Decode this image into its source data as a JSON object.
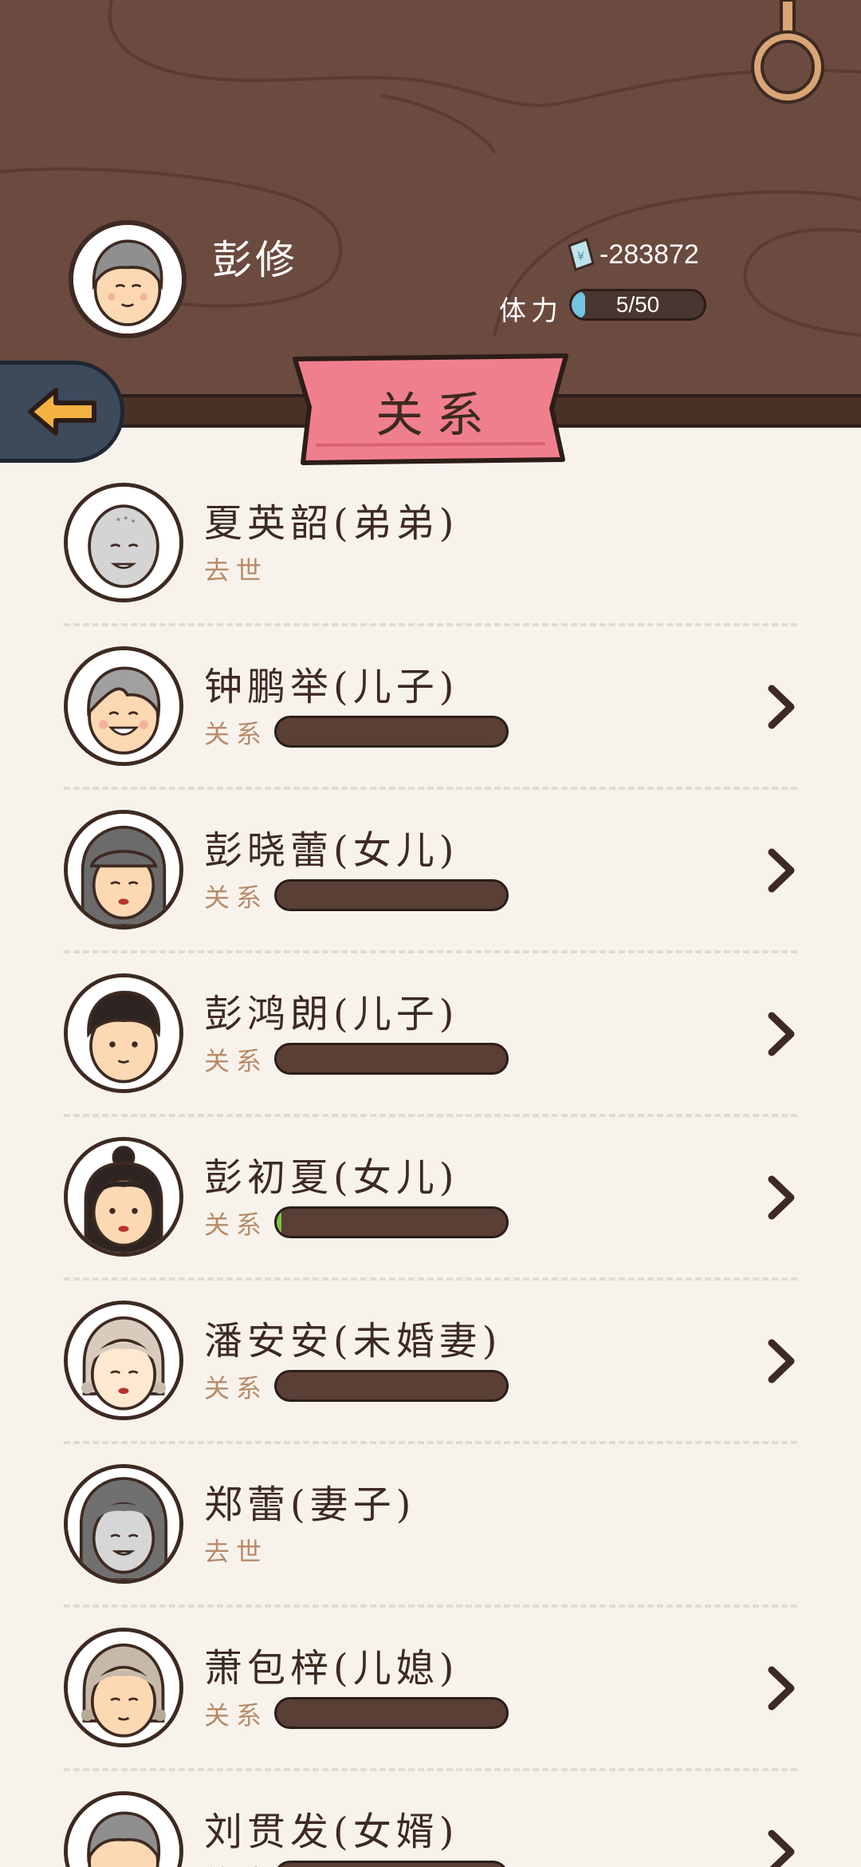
{
  "header": {
    "player_name": "彭修",
    "money": "-283872",
    "stamina_label": "体力",
    "stamina_text": "5/50",
    "stamina_fraction": 0.1,
    "back_icon": "arrow-left-icon"
  },
  "page_title": "关系",
  "members": [
    {
      "name": "夏英韶(弟弟)",
      "status": "去世",
      "deceased": true,
      "relation_fraction": 0
    },
    {
      "name": "钟鹏举(儿子)",
      "status": "关系",
      "deceased": false,
      "relation_fraction": 0
    },
    {
      "name": "彭晓蕾(女儿)",
      "status": "关系",
      "deceased": false,
      "relation_fraction": 0
    },
    {
      "name": "彭鸿朗(儿子)",
      "status": "关系",
      "deceased": false,
      "relation_fraction": 0
    },
    {
      "name": "彭初夏(女儿)",
      "status": "关系",
      "deceased": false,
      "relation_fraction": 0.02
    },
    {
      "name": "潘安安(未婚妻)",
      "status": "关系",
      "deceased": false,
      "relation_fraction": 0
    },
    {
      "name": "郑蕾(妻子)",
      "status": "去世",
      "deceased": true,
      "relation_fraction": 0
    },
    {
      "name": "萧包梓(儿媳)",
      "status": "关系",
      "deceased": false,
      "relation_fraction": 0
    },
    {
      "name": "刘贯发(女婿)",
      "status": "关系",
      "deceased": false,
      "relation_fraction": 0
    }
  ],
  "colors": {
    "header_bg": "#6b4a3f",
    "page_bg": "#f7f3ec",
    "ribbon": "#f07f8e",
    "bar_bg": "#5a3f36",
    "stamina_fill": "#73c4e0",
    "relation_fill": "#79c83f",
    "status_text": "#b88b6a"
  }
}
